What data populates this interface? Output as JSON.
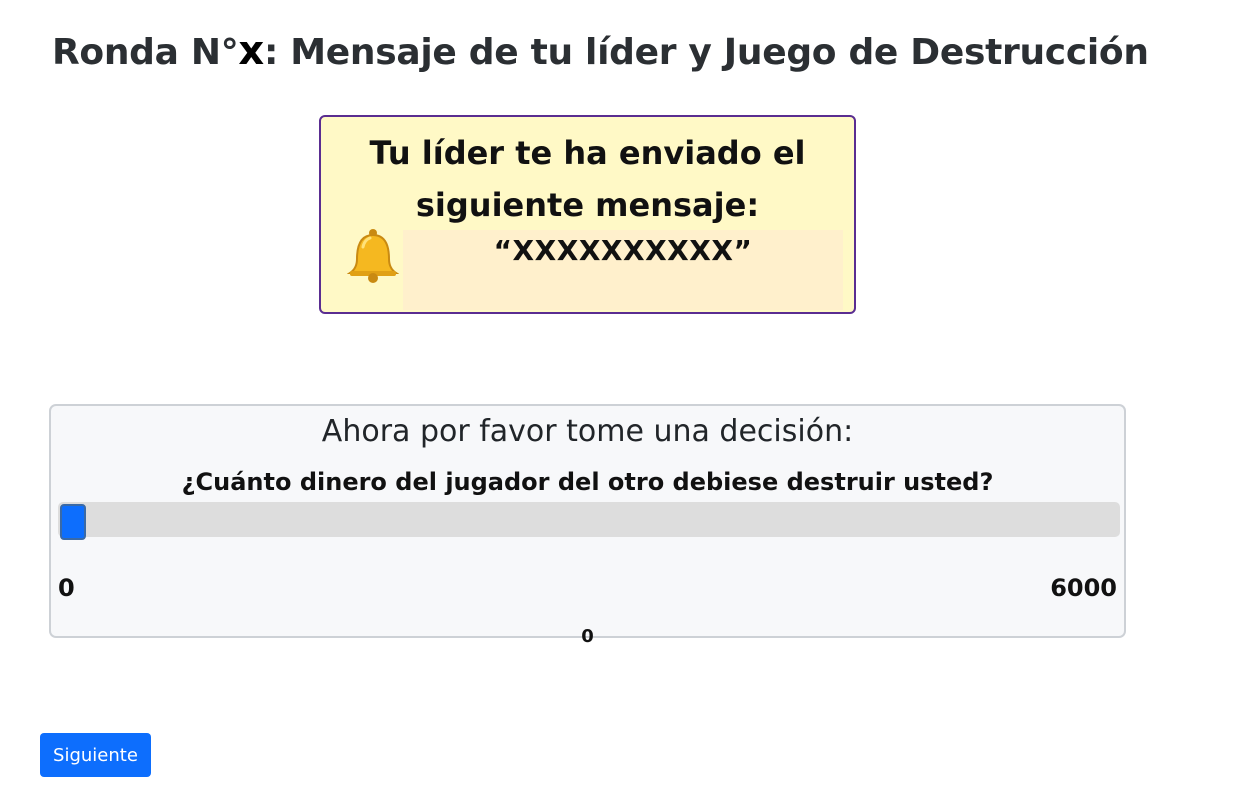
{
  "header": {
    "title_prefix": "Ronda N°",
    "round_number": "x",
    "title_suffix": ": Mensaje de tu líder y Juego de Destrucción"
  },
  "leader_message": {
    "heading": "Tu líder te ha enviado el siguiente mensaje:",
    "icon": "bell-icon",
    "message": "“XXXXXXXXXX”"
  },
  "decision": {
    "prompt": "Ahora por favor tome una decisión:",
    "question": "¿Cuánto dinero del jugador del otro debiese destruir usted?",
    "slider": {
      "min_label": "0",
      "max_label": "6000",
      "min": 0,
      "max": 6000,
      "value": 0,
      "value_label": "0"
    }
  },
  "footer": {
    "next_label": "Siguiente"
  },
  "colors": {
    "primary": "#0d6efd",
    "message_bg": "#fff9c6",
    "message_border": "#5a2d91",
    "card_bg": "#f7f8fa"
  }
}
